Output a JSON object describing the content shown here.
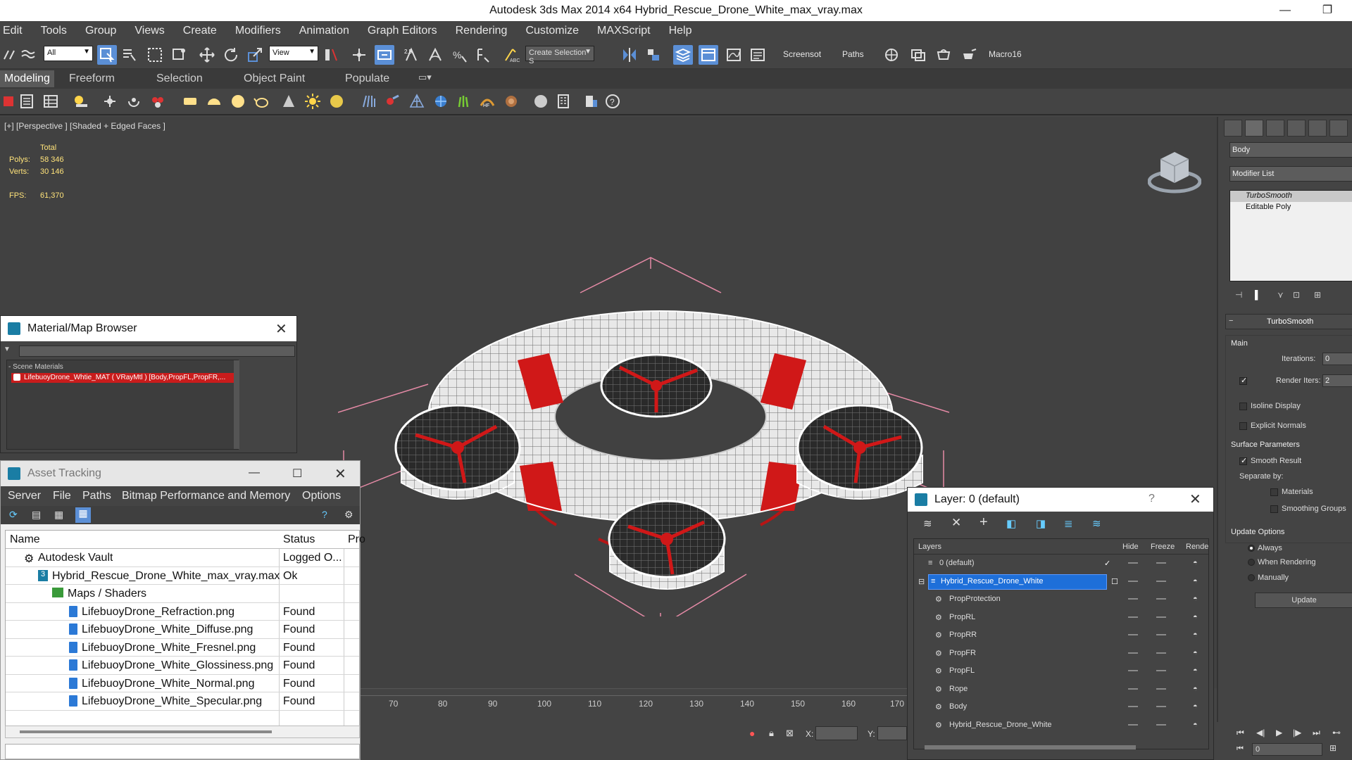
{
  "window": {
    "title": "Autodesk 3ds Max  2014 x64      Hybrid_Rescue_Drone_White_max_vray.max",
    "minimize": "—",
    "restore": "❐"
  },
  "menu": [
    "Edit",
    "Tools",
    "Group",
    "Views",
    "Create",
    "Modifiers",
    "Animation",
    "Graph Editors",
    "Rendering",
    "Customize",
    "MAXScript",
    "Help"
  ],
  "toolbar": {
    "filter_value": "All",
    "refcoord_value": "View",
    "snap_value": "2.5",
    "named_selection_placeholder": "Create Selection S",
    "screenshot_label": "Screensot",
    "paths_label": "Paths",
    "macro_label": "Macro16"
  },
  "ribbon": [
    "Modeling",
    "Freeform",
    "Selection",
    "Object Paint",
    "Populate"
  ],
  "viewport": {
    "label": "[+] [Perspective ] [Shaded + Edged Faces ]",
    "stats_total": "Total",
    "polys_label": "Polys:",
    "polys_value": "58 346",
    "verts_label": "Verts:",
    "verts_value": "30 146",
    "fps_label": "FPS:",
    "fps_value": "61,370"
  },
  "command_panel": {
    "object_name": "Body",
    "modifier_list": "Modifier List",
    "stack": [
      "TurboSmooth",
      "Editable Poly"
    ],
    "rollout_title": "TurboSmooth",
    "main_label": "Main",
    "iterations_label": "Iterations:",
    "iterations_value": "0",
    "render_iters_label": "Render Iters:",
    "render_iters_value": "2",
    "isoline": "Isoline Display",
    "explicit_normals": "Explicit Normals",
    "surface_params": "Surface Parameters",
    "smooth_result": "Smooth Result",
    "separate_by": "Separate by:",
    "materials": "Materials",
    "smoothing_groups": "Smoothing Groups",
    "update_options": "Update Options",
    "always": "Always",
    "when_rendering": "When Rendering",
    "manually": "Manually",
    "update_button": "Update"
  },
  "material_browser": {
    "title": "Material/Map Browser",
    "section": "- Scene Materials",
    "item": "LifebuoyDrone_Whtie_MAT ( VRayMtl ) [Body,PropFL,PropFR,..."
  },
  "asset_tracking": {
    "title": "Asset Tracking",
    "menu": [
      "Server",
      "File",
      "Paths",
      "Bitmap Performance and Memory",
      "Options"
    ],
    "columns": [
      "Name",
      "Status",
      "Pro"
    ],
    "rows": [
      {
        "name": "Autodesk Vault",
        "status": "Logged O..."
      },
      {
        "name": "Hybrid_Rescue_Drone_White_max_vray.max",
        "status": "Ok"
      },
      {
        "name": "Maps / Shaders",
        "status": ""
      },
      {
        "name": "LifebuoyDrone_Refraction.png",
        "status": "Found"
      },
      {
        "name": "LifebuoyDrone_White_Diffuse.png",
        "status": "Found"
      },
      {
        "name": "LifebuoyDrone_White_Fresnel.png",
        "status": "Found"
      },
      {
        "name": "LifebuoyDrone_White_Glossiness.png",
        "status": "Found"
      },
      {
        "name": "LifebuoyDrone_White_Normal.png",
        "status": "Found"
      },
      {
        "name": "LifebuoyDrone_White_Specular.png",
        "status": "Found"
      }
    ]
  },
  "layer_explorer": {
    "title": "Layer: 0 (default)",
    "help": "?",
    "columns": [
      "Layers",
      "Hide",
      "Freeze",
      "Rende"
    ],
    "rows": [
      {
        "name": "0 (default)"
      },
      {
        "name": "Hybrid_Rescue_Drone_White"
      },
      {
        "name": "PropProtection"
      },
      {
        "name": "PropRL"
      },
      {
        "name": "PropRR"
      },
      {
        "name": "PropFR"
      },
      {
        "name": "PropFL"
      },
      {
        "name": "Rope"
      },
      {
        "name": "Body"
      },
      {
        "name": "Hybrid_Rescue_Drone_White"
      }
    ]
  },
  "timeline": {
    "ticks": [
      "70",
      "80",
      "90",
      "100",
      "110",
      "120",
      "130",
      "140",
      "150",
      "160",
      "170"
    ]
  },
  "status": {
    "x_label": "X:",
    "y_label": "Y:",
    "frame_value": "0"
  },
  "colors": {
    "accent": "#5b8fd6",
    "selection": "#1e6fd9",
    "drone_red": "#d01818"
  }
}
